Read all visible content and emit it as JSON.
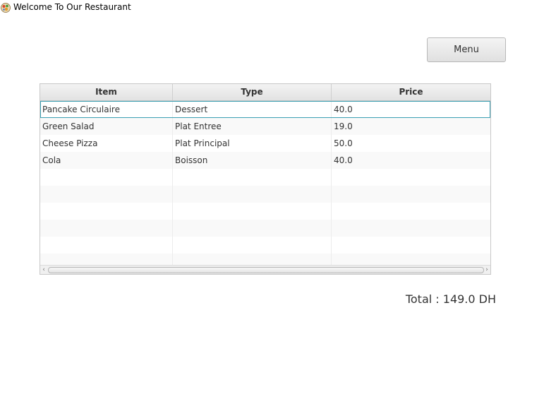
{
  "window": {
    "title": "Welcome To Our Restaurant",
    "icon": "restaurant-logo-icon"
  },
  "toolbar": {
    "menu_label": "Menu"
  },
  "table": {
    "columns": [
      "Item",
      "Type",
      "Price"
    ],
    "rows": [
      {
        "item": "Pancake Circulaire",
        "type": "Dessert",
        "price": "40.0"
      },
      {
        "item": "Green Salad",
        "type": "Plat Entree",
        "price": "19.0"
      },
      {
        "item": "Cheese Pizza",
        "type": "Plat Principal",
        "price": "50.0"
      },
      {
        "item": "Cola",
        "type": "Boisson",
        "price": "40.0"
      },
      {
        "item": "",
        "type": "",
        "price": ""
      },
      {
        "item": "",
        "type": "",
        "price": ""
      },
      {
        "item": "",
        "type": "",
        "price": ""
      },
      {
        "item": "",
        "type": "",
        "price": ""
      },
      {
        "item": "",
        "type": "",
        "price": ""
      },
      {
        "item": "",
        "type": "",
        "price": ""
      }
    ]
  },
  "summary": {
    "total_label": "Total : 149.0 DH"
  },
  "colors": {
    "selection_outline": "#3a9fb3",
    "header_bg": "#e8e8e8"
  }
}
